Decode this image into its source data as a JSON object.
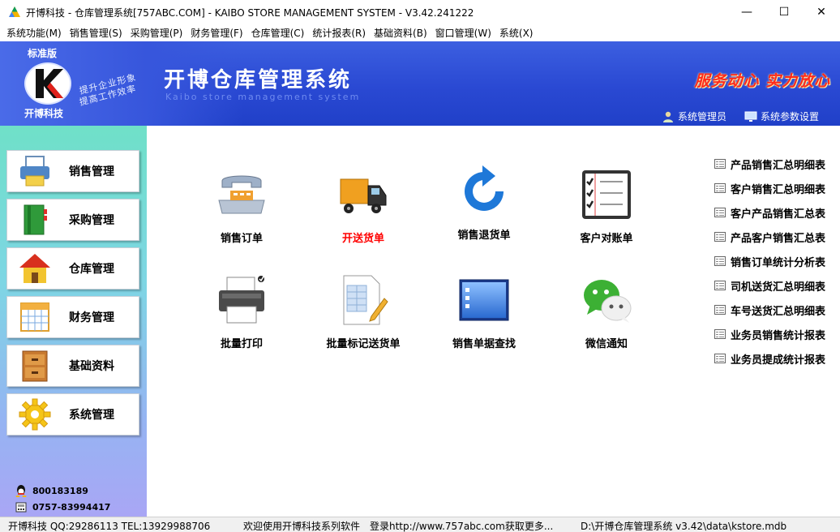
{
  "window": {
    "title": "开博科技 - 仓库管理系统[757ABC.COM] - KAIBO STORE MANAGEMENT SYSTEM - V3.42.241222",
    "minimize": "—",
    "maximize": "☐",
    "close": "✕"
  },
  "menu": [
    "系统功能(M)",
    "销售管理(S)",
    "采购管理(P)",
    "财务管理(F)",
    "仓库管理(C)",
    "统计报表(R)",
    "基础资料(B)",
    "窗口管理(W)",
    "系统(X)"
  ],
  "header": {
    "edition": "标准版",
    "company": "开博科技",
    "slogan_line1": "提升企业形象",
    "slogan_line2": "提高工作效率",
    "app_title": "开博仓库管理系统",
    "app_subtitle": "Kaibo store management system",
    "motto": "服务动心  实力放心",
    "user": "系统管理员",
    "settings": "系统参数设置"
  },
  "sidebar": {
    "items": [
      {
        "label": "销售管理",
        "icon": "printer-icon"
      },
      {
        "label": "采购管理",
        "icon": "book-icon"
      },
      {
        "label": "仓库管理",
        "icon": "house-icon"
      },
      {
        "label": "财务管理",
        "icon": "calendar-icon"
      },
      {
        "label": "基础资料",
        "icon": "cabinet-icon"
      },
      {
        "label": "系统管理",
        "icon": "gear-icon"
      }
    ],
    "contacts": [
      {
        "text": "800183189",
        "icon": "qq-icon"
      },
      {
        "text": "0757-83994417",
        "icon": "phone-icon"
      }
    ]
  },
  "tiles": [
    {
      "label": "销售订单",
      "icon": "telephone-icon",
      "highlight": false
    },
    {
      "label": "开送货单",
      "icon": "truck-icon",
      "highlight": true
    },
    {
      "label": "销售退货单",
      "icon": "refresh-icon",
      "highlight": false
    },
    {
      "label": "客户对账单",
      "icon": "checklist-icon",
      "highlight": false
    },
    {
      "label": "批量打印",
      "icon": "printer-icon",
      "highlight": false
    },
    {
      "label": "批量标记送货单",
      "icon": "spreadsheet-edit-icon",
      "highlight": false
    },
    {
      "label": "销售单据查找",
      "icon": "window-list-icon",
      "highlight": false
    },
    {
      "label": "微信通知",
      "icon": "wechat-icon",
      "highlight": false
    }
  ],
  "reports": [
    "产品销售汇总明细表",
    "客户销售汇总明细表",
    "客户产品销售汇总表",
    "产品客户销售汇总表",
    "销售订单统计分析表",
    "司机送货汇总明细表",
    "车号送货汇总明细表",
    "业务员销售统计报表",
    "业务员提成统计报表"
  ],
  "status": {
    "company": "开博科技 QQ:29286113 TEL:13929988706",
    "welcome": "欢迎使用开博科技系列软件",
    "website": "登录http://www.757abc.com获取更多...",
    "db_path": "D:\\开博仓库管理系统 v3.42\\data\\kstore.mdb"
  },
  "colors": {
    "banner": "#2a49d3",
    "motto": "#ff2a1a",
    "highlight_label": "#ff0000"
  }
}
